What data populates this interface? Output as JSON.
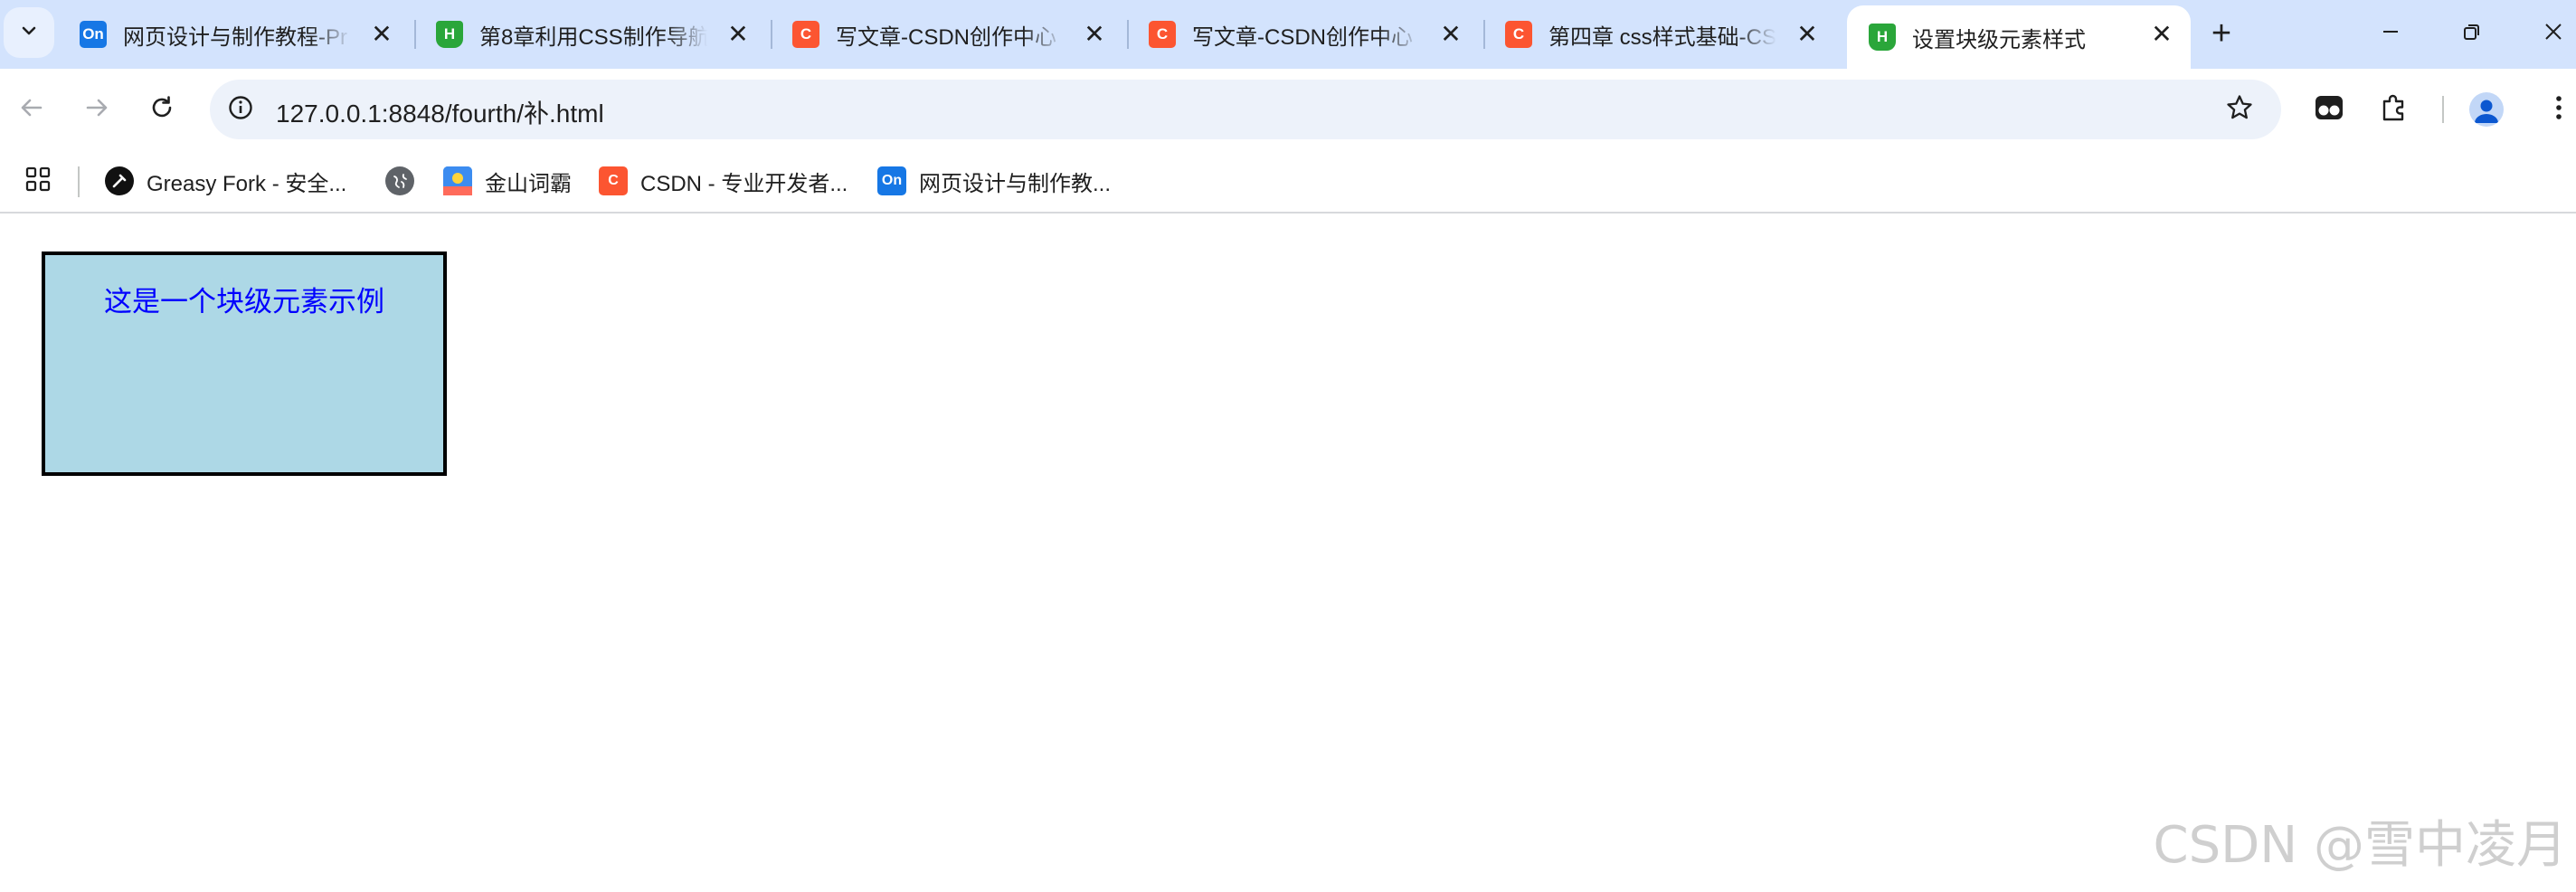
{
  "browser": {
    "tabs": [
      {
        "title": "网页设计与制作教程-Pr",
        "favicon": "on-icon",
        "favicon_text": "On",
        "active": false
      },
      {
        "title": "第8章利用CSS制作导航",
        "favicon": "hbuilder-icon",
        "favicon_text": "H",
        "active": false
      },
      {
        "title": "写文章-CSDN创作中心",
        "favicon": "csdn-icon",
        "favicon_text": "C",
        "active": false
      },
      {
        "title": "写文章-CSDN创作中心",
        "favicon": "csdn-icon",
        "favicon_text": "C",
        "active": false
      },
      {
        "title": "第四章 css样式基础-CS",
        "favicon": "csdn-icon",
        "favicon_text": "C",
        "active": false
      },
      {
        "title": "设置块级元素样式",
        "favicon": "hbuilder-icon",
        "favicon_text": "H",
        "active": true
      }
    ],
    "tab_close_glyph": "✕",
    "new_tab_glyph": "+",
    "address_bar": {
      "url": "127.0.0.1:8848/fourth/补.html"
    },
    "bookmarks": [
      {
        "label": "Greasy Fork - 安全...",
        "icon": "greasyfork-icon",
        "icon_text": ""
      },
      {
        "label": "",
        "icon": "globe-icon",
        "icon_text": ""
      },
      {
        "label": "金山词霸",
        "icon": "iciba-icon",
        "icon_text": ""
      },
      {
        "label": "CSDN - 专业开发者...",
        "icon": "csdn-icon",
        "icon_text": "C"
      },
      {
        "label": "网页设计与制作教...",
        "icon": "on-icon",
        "icon_text": "On"
      }
    ]
  },
  "colors": {
    "tabstrip_bg": "#d3e3fd",
    "block_bg": "#add8e6",
    "block_border": "#000000",
    "block_text": "#0000ff",
    "csdn_brand": "#fc5531",
    "on_brand": "#1677e5",
    "hbuilder_brand": "#2aa63a"
  },
  "page": {
    "block_text": "这是一个块级元素示例",
    "watermark": "CSDN @雪中凌月"
  }
}
